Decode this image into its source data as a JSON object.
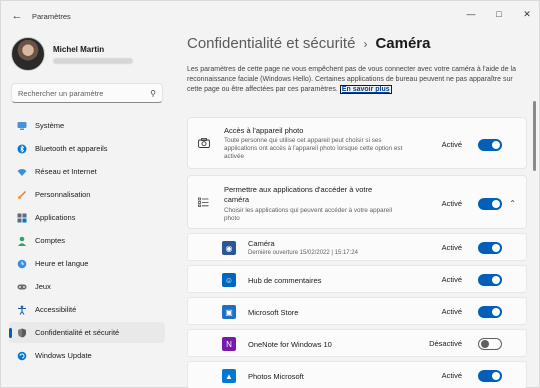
{
  "window": {
    "title": "Paramètres"
  },
  "profile": {
    "name": "Michel Martin"
  },
  "search": {
    "placeholder": "Rechercher un paramètre"
  },
  "sidebar": {
    "items": [
      {
        "label": "Système",
        "icon": "system-icon"
      },
      {
        "label": "Bluetooth et appareils",
        "icon": "bluetooth-icon"
      },
      {
        "label": "Réseau et Internet",
        "icon": "wifi-icon"
      },
      {
        "label": "Personnalisation",
        "icon": "brush-icon"
      },
      {
        "label": "Applications",
        "icon": "apps-icon"
      },
      {
        "label": "Comptes",
        "icon": "person-icon"
      },
      {
        "label": "Heure et langue",
        "icon": "globe-clock-icon"
      },
      {
        "label": "Jeux",
        "icon": "gamepad-icon"
      },
      {
        "label": "Accessibilité",
        "icon": "accessibility-icon"
      },
      {
        "label": "Confidentialité et sécurité",
        "icon": "shield-icon",
        "active": true
      },
      {
        "label": "Windows Update",
        "icon": "update-icon"
      }
    ]
  },
  "breadcrumb": {
    "parent": "Confidentialité et sécurité",
    "separator": "›",
    "current": "Caméra"
  },
  "intro": {
    "text": "Les paramètres de cette page ne vous empêchent pas de vous connecter avec votre caméra à l'aide de la reconnaissance faciale (Windows Hello). Certaines applications de bureau peuvent ne pas apparaître sur cette page ou être affectées par ces paramètres.",
    "link": "En savoir plus"
  },
  "camera_access": {
    "title": "Accès à l'appareil photo",
    "description": "Toute personne qui utilise cet appareil peut choisir si ses applications ont accès à l'appareil photo lorsque cette option est activée",
    "state": "Activé"
  },
  "app_access": {
    "title": "Permettre aux applications d'accéder à votre caméra",
    "description": "Choisir les applications qui peuvent accéder à votre appareil photo",
    "state": "Activé"
  },
  "apps": [
    {
      "name": "Caméra",
      "sub": "Dernière ouverture 15/02/2022  |  15:17:24",
      "state": "Activé",
      "on": true,
      "color": "#2b5797",
      "glyph": "◉"
    },
    {
      "name": "Hub de commentaires",
      "sub": "",
      "state": "Activé",
      "on": true,
      "color": "#0067c0",
      "glyph": "☺"
    },
    {
      "name": "Microsoft Store",
      "sub": "",
      "state": "Activé",
      "on": true,
      "color": "#1f6fc5",
      "glyph": "▣"
    },
    {
      "name": "OneNote for Windows 10",
      "sub": "",
      "state": "Désactivé",
      "on": false,
      "color": "#7719aa",
      "glyph": "N"
    },
    {
      "name": "Photos Microsoft",
      "sub": "",
      "state": "Activé",
      "on": true,
      "color": "#0078d4",
      "glyph": "▲"
    }
  ],
  "colors": {
    "accent": "#005fb8",
    "window_bg": "#f3f3f3",
    "card_bg": "#fbfbfb"
  }
}
